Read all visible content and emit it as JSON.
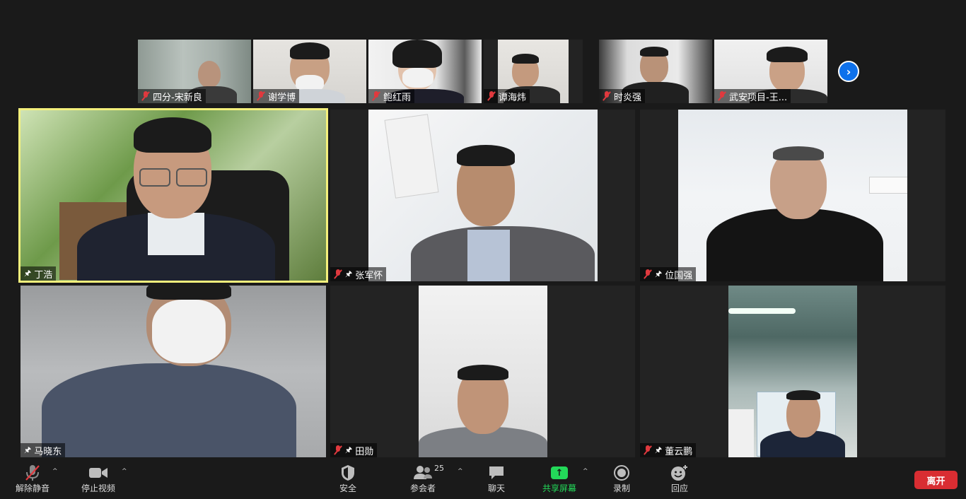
{
  "colors": {
    "active_speaker_border": "#f4f07c",
    "muted_icon": "#e0393e",
    "share_green": "#23d959",
    "leave_red": "#d92d32",
    "next_blue": "#0e71eb"
  },
  "strip": {
    "participants": [
      {
        "name": "四分-宋新良",
        "muted": true
      },
      {
        "name": "谢学博",
        "muted": true
      },
      {
        "name": "鲍红雨",
        "muted": true
      },
      {
        "name": "谭海炜",
        "muted": true
      },
      {
        "name": "时炎强",
        "muted": true
      },
      {
        "name": "武安项目-王...",
        "muted": true
      }
    ],
    "next_icon": "chevron-right-icon"
  },
  "grid": {
    "tiles": [
      {
        "name": "丁浩",
        "muted": false,
        "pinned": true,
        "active": true
      },
      {
        "name": "张军怀",
        "muted": true,
        "pinned": true,
        "active": false
      },
      {
        "name": "位国强",
        "muted": true,
        "pinned": true,
        "active": false
      },
      {
        "name": "马晓东",
        "muted": false,
        "pinned": true,
        "active": false
      },
      {
        "name": "田勋",
        "muted": true,
        "pinned": true,
        "active": false
      },
      {
        "name": "董云鹏",
        "muted": true,
        "pinned": true,
        "active": false
      }
    ]
  },
  "toolbar": {
    "unmute_label": "解除静音",
    "stop_video_label": "停止视频",
    "security_label": "安全",
    "participants_label": "参会者",
    "participants_count": "25",
    "chat_label": "聊天",
    "share_label": "共享屏幕",
    "record_label": "录制",
    "reactions_label": "回应",
    "leave_label": "离开",
    "caret": "^",
    "share_arrow": "↑"
  }
}
